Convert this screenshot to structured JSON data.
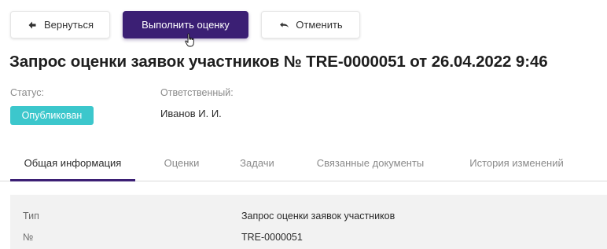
{
  "toolbar": {
    "back_label": "Вернуться",
    "evaluate_label": "Выполнить оценку",
    "cancel_label": "Отменить"
  },
  "page_title": "Запрос оценки заявок участников № TRE-0000051 от 26.04.2022 9:46",
  "status": {
    "label": "Статус:",
    "value": "Опубликован"
  },
  "responsible": {
    "label": "Ответственный:",
    "value": "Иванов И. И."
  },
  "tabs": [
    {
      "label": "Общая информация",
      "active": true
    },
    {
      "label": "Оценки",
      "active": false
    },
    {
      "label": "Задачи",
      "active": false
    },
    {
      "label": "Связанные документы",
      "active": false
    },
    {
      "label": "История изменений",
      "active": false
    }
  ],
  "general_info": [
    {
      "key": "Тип",
      "value": "Запрос оценки заявок участников"
    },
    {
      "key": "№",
      "value": "TRE-0000051"
    }
  ],
  "colors": {
    "primary": "#3b1f74",
    "status_badge": "#3cc7cc"
  },
  "icons": {
    "back": "arrow-left-icon",
    "cancel": "undo-icon",
    "cursor": "hand-pointer-icon"
  }
}
